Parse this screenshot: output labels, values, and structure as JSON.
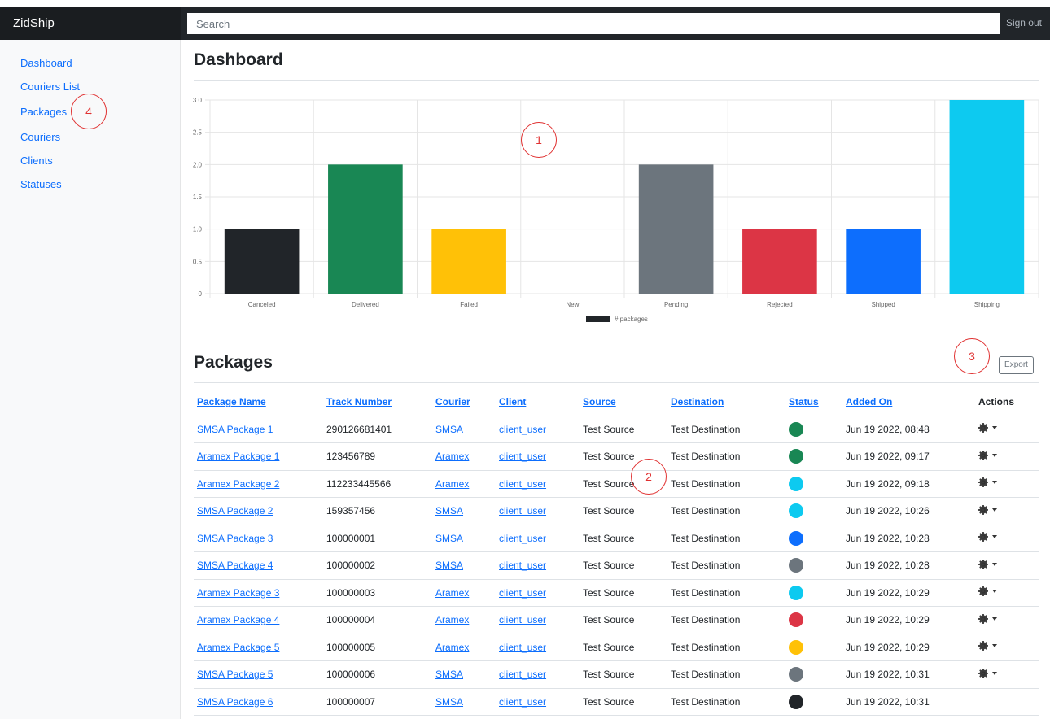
{
  "app": {
    "brand": "ZidShip",
    "search_placeholder": "Search",
    "signout_label": "Sign out"
  },
  "sidebar": {
    "items": [
      {
        "label": "Dashboard"
      },
      {
        "label": "Couriers List"
      },
      {
        "label": "Packages"
      },
      {
        "label": "Couriers"
      },
      {
        "label": "Clients"
      },
      {
        "label": "Statuses"
      }
    ]
  },
  "dashboard": {
    "title": "Dashboard"
  },
  "chart_data": {
    "type": "bar",
    "categories": [
      "Canceled",
      "Delivered",
      "Failed",
      "New",
      "Pending",
      "Rejected",
      "Shipped",
      "Shipping"
    ],
    "series": [
      {
        "name": "# packages",
        "values": [
          1,
          2,
          1,
          0,
          2,
          1,
          1,
          3
        ]
      }
    ],
    "colors": [
      "#212529",
      "#198754",
      "#ffc107",
      "#0dcaf0",
      "#6c757d",
      "#dc3545",
      "#0d6efd",
      "#0dcaf0"
    ],
    "legend_color": "#212529",
    "yticks": [
      "0",
      "0.5",
      "1.0",
      "1.5",
      "2.0",
      "2.5",
      "3.0"
    ],
    "ylim": [
      0,
      3
    ],
    "grid": true,
    "legend_position": "bottom"
  },
  "packages": {
    "title": "Packages",
    "export_label": "Export",
    "columns": [
      "Package Name",
      "Track Number",
      "Courier",
      "Client",
      "Source",
      "Destination",
      "Status",
      "Added On",
      "Actions"
    ],
    "rows": [
      {
        "name": "SMSA Package 1",
        "track": "290126681401",
        "courier": "SMSA",
        "client": "client_user",
        "source": "Test Source",
        "destination": "Test Destination",
        "status_color": "#198754",
        "added": "Jun 19 2022, 08:48",
        "has_actions": true
      },
      {
        "name": "Aramex Package 1",
        "track": "123456789",
        "courier": "Aramex",
        "client": "client_user",
        "source": "Test Source",
        "destination": "Test Destination",
        "status_color": "#198754",
        "added": "Jun 19 2022, 09:17",
        "has_actions": true
      },
      {
        "name": "Aramex Package 2",
        "track": "112233445566",
        "courier": "Aramex",
        "client": "client_user",
        "source": "Test Source",
        "destination": "Test Destination",
        "status_color": "#0dcaf0",
        "added": "Jun 19 2022, 09:18",
        "has_actions": true
      },
      {
        "name": "SMSA Package 2",
        "track": "159357456",
        "courier": "SMSA",
        "client": "client_user",
        "source": "Test Source",
        "destination": "Test Destination",
        "status_color": "#0dcaf0",
        "added": "Jun 19 2022, 10:26",
        "has_actions": true
      },
      {
        "name": "SMSA Package 3",
        "track": "100000001",
        "courier": "SMSA",
        "client": "client_user",
        "source": "Test Source",
        "destination": "Test Destination",
        "status_color": "#0d6efd",
        "added": "Jun 19 2022, 10:28",
        "has_actions": true
      },
      {
        "name": "SMSA Package 4",
        "track": "100000002",
        "courier": "SMSA",
        "client": "client_user",
        "source": "Test Source",
        "destination": "Test Destination",
        "status_color": "#6c757d",
        "added": "Jun 19 2022, 10:28",
        "has_actions": true
      },
      {
        "name": "Aramex Package 3",
        "track": "100000003",
        "courier": "Aramex",
        "client": "client_user",
        "source": "Test Source",
        "destination": "Test Destination",
        "status_color": "#0dcaf0",
        "added": "Jun 19 2022, 10:29",
        "has_actions": true
      },
      {
        "name": "Aramex Package 4",
        "track": "100000004",
        "courier": "Aramex",
        "client": "client_user",
        "source": "Test Source",
        "destination": "Test Destination",
        "status_color": "#dc3545",
        "added": "Jun 19 2022, 10:29",
        "has_actions": true
      },
      {
        "name": "Aramex Package 5",
        "track": "100000005",
        "courier": "Aramex",
        "client": "client_user",
        "source": "Test Source",
        "destination": "Test Destination",
        "status_color": "#ffc107",
        "added": "Jun 19 2022, 10:29",
        "has_actions": true
      },
      {
        "name": "SMSA Package 5",
        "track": "100000006",
        "courier": "SMSA",
        "client": "client_user",
        "source": "Test Source",
        "destination": "Test Destination",
        "status_color": "#6c757d",
        "added": "Jun 19 2022, 10:31",
        "has_actions": true
      },
      {
        "name": "SMSA Package 6",
        "track": "100000007",
        "courier": "SMSA",
        "client": "client_user",
        "source": "Test Source",
        "destination": "Test Destination",
        "status_color": "#212529",
        "added": "Jun 19 2022, 10:31",
        "has_actions": false
      }
    ]
  },
  "annotations": [
    "1",
    "2",
    "3",
    "4"
  ]
}
